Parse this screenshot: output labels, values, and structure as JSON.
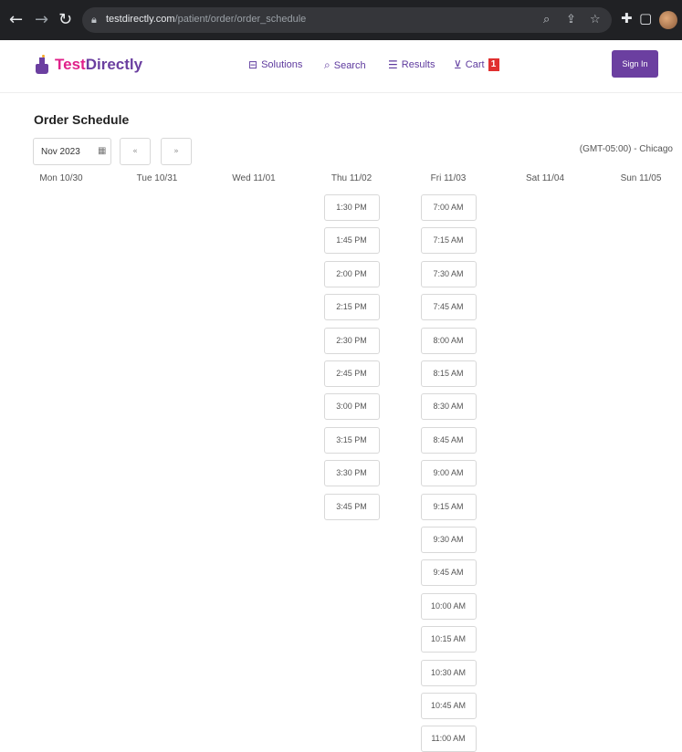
{
  "browser": {
    "url_host": "testdirectly.com",
    "url_path": "/patient/order/order_schedule"
  },
  "header": {
    "logo_part1": "Test",
    "logo_part2": "Directly",
    "nav": [
      {
        "label": "Solutions",
        "icon": "briefcase-icon"
      },
      {
        "label": "Search",
        "icon": "search-icon"
      },
      {
        "label": "Results",
        "icon": "results-icon"
      },
      {
        "label": "Cart",
        "icon": "cart-icon"
      }
    ],
    "cart_count": "1",
    "signin_label": "Sign In"
  },
  "schedule": {
    "title": "Order Schedule",
    "month": "Nov 2023",
    "prev_label": "«",
    "next_label": "»",
    "timezone": "(GMT-05:00) - Chicago",
    "days": [
      {
        "label": "Mon 10/30",
        "slots": []
      },
      {
        "label": "Tue 10/31",
        "slots": []
      },
      {
        "label": "Wed 11/01",
        "slots": []
      },
      {
        "label": "Thu 11/02",
        "slots": [
          "1:30 PM",
          "1:45 PM",
          "2:00 PM",
          "2:15 PM",
          "2:30 PM",
          "2:45 PM",
          "3:00 PM",
          "3:15 PM",
          "3:30 PM",
          "3:45 PM"
        ]
      },
      {
        "label": "Fri 11/03",
        "slots": [
          "7:00 AM",
          "7:15 AM",
          "7:30 AM",
          "7:45 AM",
          "8:00 AM",
          "8:15 AM",
          "8:30 AM",
          "8:45 AM",
          "9:00 AM",
          "9:15 AM",
          "9:30 AM",
          "9:45 AM",
          "10:00 AM",
          "10:15 AM",
          "10:30 AM",
          "10:45 AM",
          "11:00 AM"
        ]
      },
      {
        "label": "Sat 11/04",
        "slots": []
      },
      {
        "label": "Sun 11/05",
        "slots": []
      }
    ]
  },
  "colors": {
    "brand_purple": "#6b3fa0",
    "brand_pink": "#e0218a",
    "cart_badge": "#e03030"
  }
}
